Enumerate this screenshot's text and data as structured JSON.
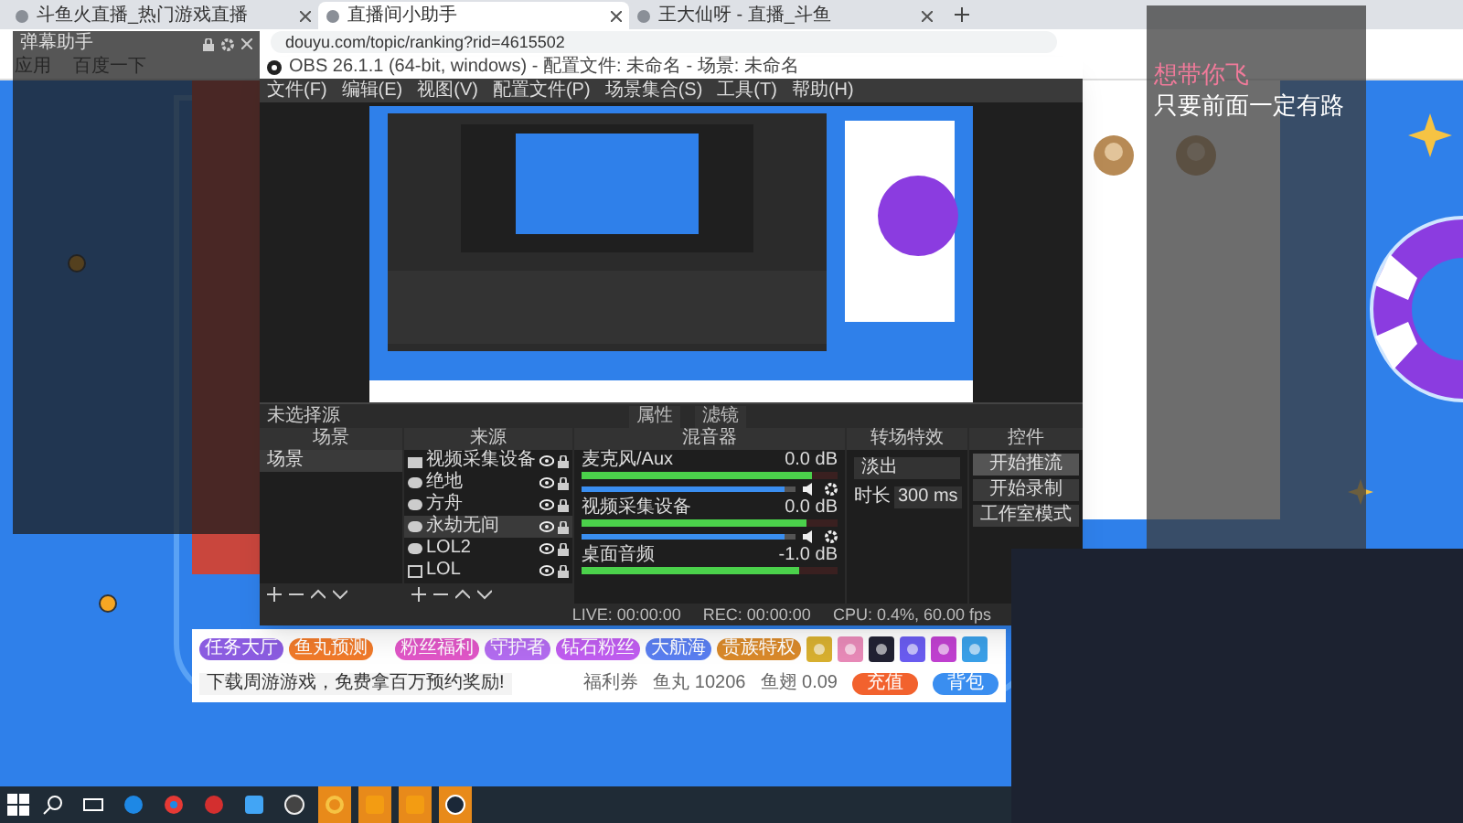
{
  "browser": {
    "tabs": [
      {
        "label": "斗鱼火直播_热门游戏直播",
        "selected": false
      },
      {
        "label": "直播间小助手",
        "selected": true
      },
      {
        "label": "王大仙呀 - 直播_斗鱼",
        "selected": false
      }
    ],
    "url": "douyu.com/topic/ranking?rid=4615502",
    "bookmarks": [
      "应用",
      "百度一下"
    ]
  },
  "danmu_panel": {
    "title": "弹幕助手"
  },
  "obs": {
    "title": "OBS 26.1.1 (64-bit, windows) - 配置文件: 未命名 - 场景: 未命名",
    "menu": [
      "文件(F)",
      "编辑(E)",
      "视图(V)",
      "配置文件(P)",
      "场景集合(S)",
      "工具(T)",
      "帮助(H)"
    ],
    "source_toolbar": {
      "label": "未选择源",
      "buttons": [
        "属性",
        "滤镜"
      ]
    },
    "scenes": {
      "title": "场景",
      "items": [
        {
          "label": "场景",
          "selected": true
        }
      ]
    },
    "sources": {
      "title": "来源",
      "items": [
        {
          "label": "视频采集设备",
          "kind": "camera",
          "visible": true,
          "selected": false
        },
        {
          "label": "绝地",
          "kind": "game",
          "visible": true,
          "selected": false
        },
        {
          "label": "方舟",
          "kind": "game",
          "visible": true,
          "selected": false
        },
        {
          "label": "永劫无间",
          "kind": "game",
          "visible": true,
          "selected": true
        },
        {
          "label": "LOL2",
          "kind": "game",
          "visible": true,
          "selected": false
        },
        {
          "label": "LOL",
          "kind": "window",
          "visible": true,
          "selected": false
        }
      ]
    },
    "mixer": {
      "title": "混音器",
      "channels": [
        {
          "name": "麦克风/Aux",
          "reading": "0.0 dB",
          "meter": {
            "level": 0.9
          },
          "volume": {
            "level": 0.95
          }
        },
        {
          "name": "视频采集设备",
          "reading": "0.0 dB",
          "meter": {
            "level": 0.88
          },
          "volume": {
            "level": 0.95
          }
        },
        {
          "name": "桌面音频",
          "reading": "-1.0 dB",
          "meter": {
            "level": 0.85
          }
        }
      ]
    },
    "transitions": {
      "title": "转场特效",
      "type": "淡出",
      "duration_label": "时长",
      "duration": "300 ms"
    },
    "controls": {
      "title": "控件",
      "buttons": [
        {
          "label": "开始推流",
          "selected": true
        },
        {
          "label": "开始录制",
          "selected": false
        },
        {
          "label": "工作室模式",
          "selected": false
        }
      ]
    },
    "status_bar": {
      "live": "LIVE: 00:00:00",
      "rec": "REC: 00:00:00",
      "cpu": "CPU: 0.4%, 60.00 fps"
    }
  },
  "stream_bar": {
    "left_items": [
      "任务大厅",
      "鱼丸预测"
    ],
    "activities": [
      "粉丝福利",
      "守护者",
      "钻石粉丝",
      "大航海",
      "贵族特权"
    ],
    "notice": "下载周游游戏，免费拿百万预约奖励!",
    "coupon": "福利券",
    "yuwan": "鱼丸 10206",
    "yuchi": "鱼翅 0.09",
    "recharge": "充值",
    "backpack": "背包"
  },
  "overlay": {
    "line_1": "想带你飞",
    "line_2": "只要前面一定有路"
  },
  "taskbar": {
    "apps": [
      {
        "kind": "search",
        "active": false
      },
      {
        "kind": "taskview",
        "active": false
      },
      {
        "kind": "edge",
        "active": false
      },
      {
        "kind": "chrome",
        "active": false
      },
      {
        "kind": "netease",
        "active": false
      },
      {
        "kind": "blue",
        "active": false
      },
      {
        "kind": "obs",
        "active": false
      },
      {
        "kind": "yellow",
        "active": true
      },
      {
        "kind": "orange",
        "active": true
      },
      {
        "kind": "orange",
        "active": true
      },
      {
        "kind": "steam",
        "active": true
      }
    ]
  }
}
